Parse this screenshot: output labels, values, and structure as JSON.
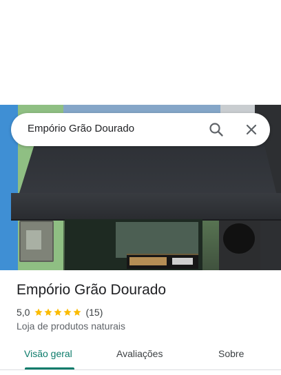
{
  "search": {
    "query": "Empório Grão Dourado",
    "search_icon": "search-icon",
    "close_icon": "close-icon"
  },
  "place": {
    "title": "Empório Grão Dourado",
    "rating": "5,0",
    "stars": 5,
    "review_count": "(15)",
    "category": "Loja de produtos naturais"
  },
  "tabs": [
    {
      "label": "Visão geral",
      "active": true
    },
    {
      "label": "Avaliações",
      "active": false
    },
    {
      "label": "Sobre",
      "active": false
    }
  ],
  "colors": {
    "accent": "#0b7b6a",
    "star": "#fbbc04",
    "text": "#202124",
    "secondary_text": "#5f6368"
  }
}
